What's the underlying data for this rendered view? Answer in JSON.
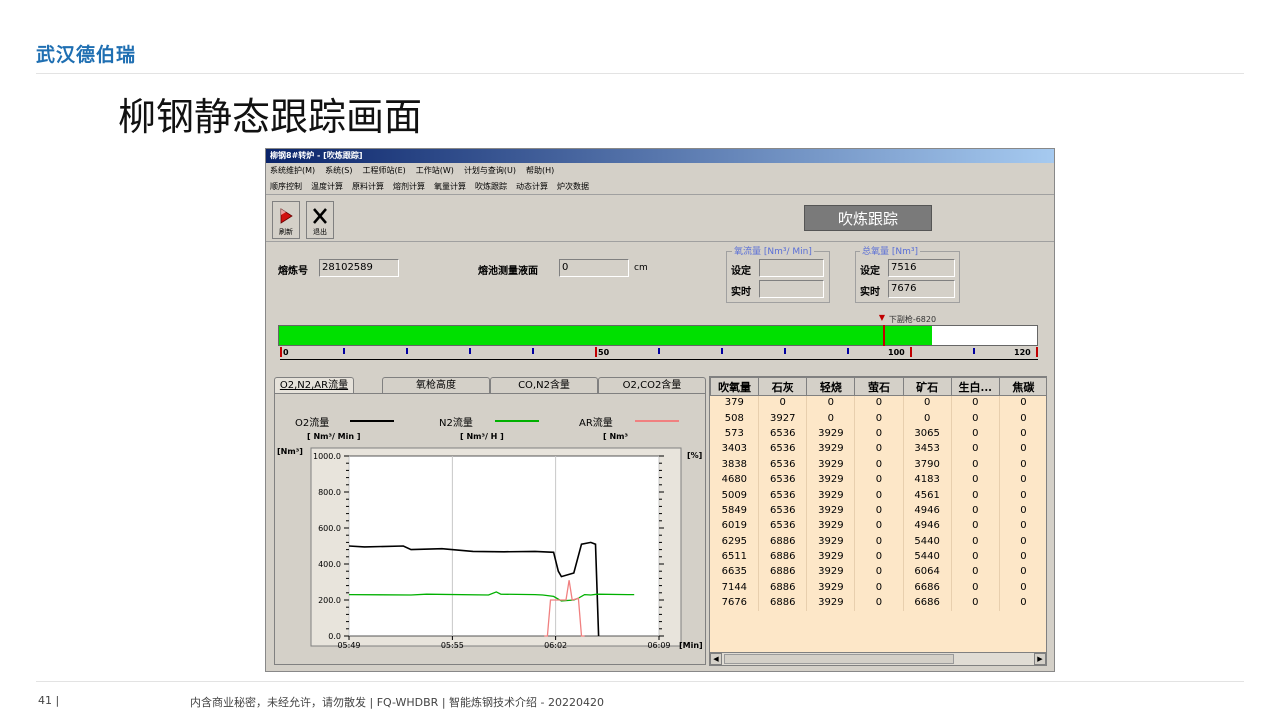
{
  "slide": {
    "brand": "武汉德伯瑞",
    "title": "柳钢静态跟踪画面",
    "page_number": "41 |",
    "footer": "内含商业秘密，未经允许，请勿散发 | FQ-WHDBR | 智能炼钢技术介绍 - 20220420"
  },
  "window": {
    "title": "柳钢8#转炉 - [吹炼跟踪]",
    "menu": [
      "系统维护(M)",
      "系统(S)",
      "工程师站(E)",
      "工作站(W)",
      "计划与查询(U)",
      "帮助(H)"
    ],
    "toolbar_menu": [
      "顺序控制",
      "温度计算",
      "原料计算",
      "熔剂计算",
      "氧量计算",
      "吹炼跟踪",
      "动态计算",
      "炉次数据"
    ],
    "buttons": {
      "refresh": "刷新",
      "exit": "退出"
    },
    "screen_title": "吹炼跟踪"
  },
  "heat": {
    "heat_no_label": "熔炼号",
    "heat_no": "28102589",
    "bath_level_label": "熔池测量液面",
    "bath_level": "0",
    "bath_level_unit": "cm"
  },
  "oxygen_flow": {
    "title": "氧流量 [Nm³/ Min]",
    "set_label": "设定",
    "set_value": "",
    "actual_label": "实时",
    "actual_value": ""
  },
  "total_oxygen": {
    "title": "总氧量 [Nm³]",
    "set_label": "设定",
    "set_value": "7516",
    "actual_label": "实时",
    "actual_value": "7676"
  },
  "progress": {
    "fraction": 0.862,
    "max": 120,
    "marker_label": "下副枪-6820",
    "marker_value": 95.5,
    "tick_labels": [
      "0",
      "50",
      "100",
      "120"
    ],
    "colors": {
      "fill": "#00e000",
      "marker": "#c00000"
    }
  },
  "tabs": [
    "O2,N2,AR流量",
    "氧枪高度",
    "CO,N2含量",
    "O2,CO2含量"
  ],
  "legend": [
    {
      "name": "O2流量",
      "unit": "[ Nm³/ Min ]",
      "color": "#000000"
    },
    {
      "name": "N2流量",
      "unit": "[ Nm³/ H ]",
      "color": "#00b000"
    },
    {
      "name": "AR流量",
      "unit": "[ Nm³",
      "color": "#f08080"
    }
  ],
  "chart_data": {
    "type": "line",
    "ylabel_left": "[Nm³]",
    "ylabel_right": "[%]",
    "xlabel": "[Min]",
    "x_ticks": [
      "05:49",
      "05:55",
      "06:02",
      "06:09"
    ],
    "y_ticks": [
      "0.0",
      "200.0",
      "400.0",
      "600.0",
      "800.0",
      "1000.0"
    ],
    "xlim": [
      0,
      20
    ],
    "ylim": [
      0,
      1000
    ],
    "series": [
      {
        "name": "O2流量",
        "color": "#000000",
        "x": [
          0,
          1.0,
          3.5,
          4.0,
          6.0,
          8.0,
          10.0,
          12.0,
          13.2,
          13.5,
          13.7,
          14.5,
          15.0,
          15.6,
          15.9,
          16.1
        ],
        "y": [
          500,
          495,
          500,
          480,
          485,
          470,
          468,
          470,
          465,
          360,
          330,
          350,
          510,
          520,
          510,
          0
        ]
      },
      {
        "name": "N2流量",
        "color": "#00b000",
        "x": [
          0,
          4.0,
          5.0,
          9.0,
          9.5,
          9.8,
          12.0,
          12.5,
          13.2,
          13.7,
          14.5,
          14.8,
          15.2,
          15.6,
          16.0,
          18.0,
          18.4
        ],
        "y": [
          230,
          228,
          232,
          228,
          245,
          232,
          230,
          228,
          220,
          195,
          200,
          210,
          230,
          228,
          232,
          230,
          230
        ]
      },
      {
        "name": "AR流量",
        "color": "#f08080",
        "x": [
          12.6,
          12.8,
          13.0,
          14.0,
          14.2,
          14.4,
          14.8,
          15.0,
          15.2
        ],
        "y": [
          0,
          0,
          200,
          200,
          310,
          200,
          210,
          0,
          0
        ]
      }
    ]
  },
  "grid": {
    "columns": [
      "吹氧量",
      "石灰",
      "轻烧",
      "萤石",
      "矿石",
      "生白...",
      "焦碳"
    ],
    "rows": [
      [
        "379",
        "0",
        "0",
        "0",
        "0",
        "0",
        "0"
      ],
      [
        "508",
        "3927",
        "0",
        "0",
        "0",
        "0",
        "0"
      ],
      [
        "573",
        "6536",
        "3929",
        "0",
        "3065",
        "0",
        "0"
      ],
      [
        "3403",
        "6536",
        "3929",
        "0",
        "3453",
        "0",
        "0"
      ],
      [
        "3838",
        "6536",
        "3929",
        "0",
        "3790",
        "0",
        "0"
      ],
      [
        "4680",
        "6536",
        "3929",
        "0",
        "4183",
        "0",
        "0"
      ],
      [
        "5009",
        "6536",
        "3929",
        "0",
        "4561",
        "0",
        "0"
      ],
      [
        "5849",
        "6536",
        "3929",
        "0",
        "4946",
        "0",
        "0"
      ],
      [
        "6019",
        "6536",
        "3929",
        "0",
        "4946",
        "0",
        "0"
      ],
      [
        "6295",
        "6886",
        "3929",
        "0",
        "5440",
        "0",
        "0"
      ],
      [
        "6511",
        "6886",
        "3929",
        "0",
        "5440",
        "0",
        "0"
      ],
      [
        "6635",
        "6886",
        "3929",
        "0",
        "6064",
        "0",
        "0"
      ],
      [
        "7144",
        "6886",
        "3929",
        "0",
        "6686",
        "0",
        "0"
      ],
      [
        "7676",
        "6886",
        "3929",
        "0",
        "6686",
        "0",
        "0"
      ]
    ]
  }
}
